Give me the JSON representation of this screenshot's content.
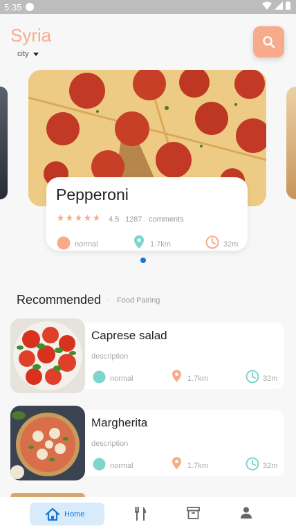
{
  "status_bar": {
    "time": "5:35"
  },
  "header": {
    "title": "Syria",
    "city_label": "city"
  },
  "featured": {
    "title": "Pepperoni",
    "rating": "4.5",
    "comment_count": "1287",
    "comments_label": "comments",
    "level": "normal",
    "distance": "1.7km",
    "time": "32m"
  },
  "section": {
    "title": "Recommended",
    "separator": "·",
    "subtitle": "Food Pairing"
  },
  "recommended": [
    {
      "title": "Caprese salad",
      "description": "description",
      "level": "normal",
      "distance": "1.7km",
      "time": "32m"
    },
    {
      "title": "Margherita",
      "description": "description",
      "level": "normal",
      "distance": "1.7km",
      "time": "32m"
    }
  ],
  "bottom_nav": {
    "home_label": "Home"
  },
  "colors": {
    "accent": "#f7ab8b",
    "primary": "#1976d2",
    "teal": "#7dd6cc"
  }
}
